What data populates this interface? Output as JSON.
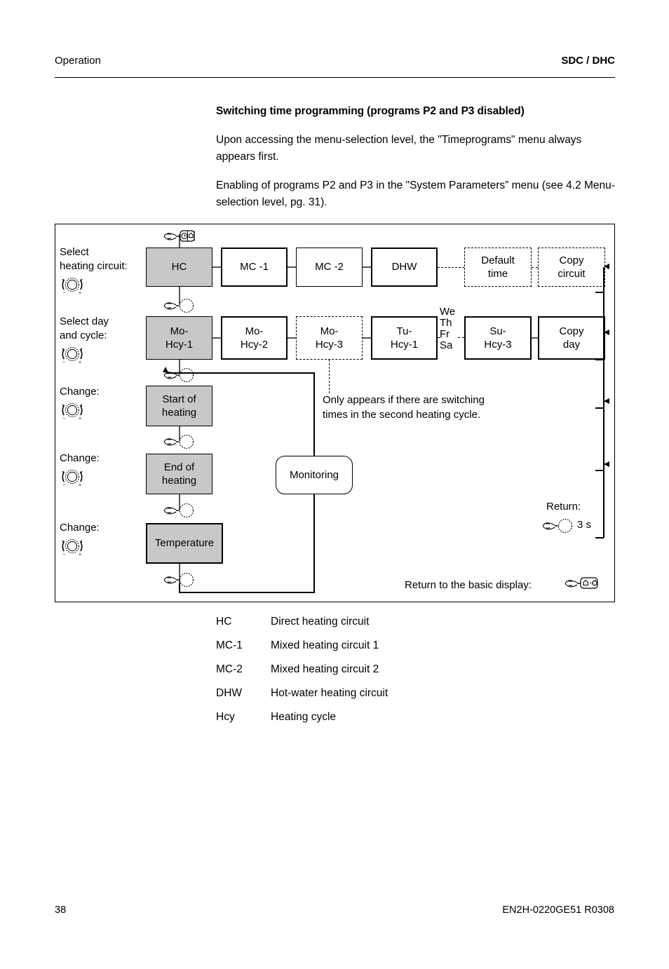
{
  "header": {
    "left": "Operation",
    "right": "SDC / DHC"
  },
  "intro": {
    "heading": "Switching time programming (programs P2 and P3 disabled)",
    "paragraph1": "Upon accessing the menu-selection level, the \"Timeprograms\" menu always appears first.",
    "paragraph2": "Enabling of programs P2 and P3 in the \"System Parameters” menu (see 4.2 Menu-selection level, pg. 31)."
  },
  "diagram": {
    "row_labels": {
      "select_circuit": "Select\nheating circuit:",
      "select_day": "Select day\nand cycle:",
      "change1": "Change:",
      "change2": "Change:",
      "change3": "Change:"
    },
    "left_labels": [
      {
        "id": "select-heating-circuit",
        "line1": "Select",
        "line2": "heating circuit:"
      },
      {
        "id": "select-day-and-cycle",
        "line1": "Select day",
        "line2": "and cycle:"
      },
      {
        "id": "change-start-heating",
        "line1": "Change:",
        "line2": ""
      },
      {
        "id": "change-end-heating",
        "line1": "Change:",
        "line2": ""
      },
      {
        "id": "change-temperature",
        "line1": "Change:",
        "line2": ""
      }
    ],
    "row_circuits": [
      {
        "id": "hc",
        "label": "HC",
        "style": "shaded"
      },
      {
        "id": "mc-1",
        "label": "MC -1",
        "style": "thick"
      },
      {
        "id": "mc-2",
        "label": "MC -2",
        "style": "plain"
      },
      {
        "id": "dhw",
        "label": "DHW",
        "style": "thick"
      },
      {
        "id": "default-time",
        "label": "Default\ntime",
        "style": "dashed"
      },
      {
        "id": "copy-circuit",
        "label": "Copy\ncircuit",
        "style": "dashed"
      }
    ],
    "row_circuits_text": {
      "hc": "HC",
      "mc1": "MC -1",
      "mc2": "MC -2",
      "dhw": "DHW",
      "default_time_l1": "Default",
      "default_time_l2": "time",
      "copy_circuit_l1": "Copy",
      "copy_circuit_l2": "circuit"
    },
    "row_days_text": {
      "mo_hcy1_l1": "Mo-",
      "mo_hcy1_l2": "Hcy-1",
      "mo_hcy2_l1": "Mo-",
      "mo_hcy2_l2": "Hcy-2",
      "mo_hcy3_l1": "Mo-",
      "mo_hcy3_l2": "Hcy-3",
      "tu_hcy1_l1": "Tu-",
      "tu_hcy1_l2": "Hcy-1",
      "su_hcy3_l1": "Su-",
      "su_hcy3_l2": "Hcy-3",
      "copy_day_l1": "Copy",
      "copy_day_l2": "day",
      "weekdays": "We\nTh\nFr\nSa"
    },
    "weekday_lines": [
      "We",
      "Th",
      "Fr",
      "Sa"
    ],
    "steps_text": {
      "start_of_heating_l1": "Start of",
      "start_of_heating_l2": "heating",
      "end_of_heating_l1": "End of",
      "end_of_heating_l2": "heating",
      "temperature": "Temperature",
      "monitoring": "Monitoring"
    },
    "note": {
      "line1": "Only appears if there are switching",
      "line2": "times in the second heating cycle."
    },
    "return": {
      "label": "Return:",
      "duration": "3 s"
    },
    "basic_display": {
      "label": "Return to the basic display:"
    },
    "icons": {
      "knob": "rotary-knob-icon",
      "press_knob": "hand-press-knob-icon",
      "press_timeprog": "hand-press-timeprogram-button-icon",
      "press_home": "hand-press-home-button-icon"
    },
    "colors": {
      "shaded_box": "#c8c8c8",
      "outline": "#000000",
      "connector": "#555555"
    }
  },
  "glossary": [
    {
      "key": "HC",
      "value": "Direct heating circuit"
    },
    {
      "key": "MC-1",
      "value": "Mixed heating circuit 1"
    },
    {
      "key": "MC-2",
      "value": "Mixed heating circuit 2"
    },
    {
      "key": "DHW",
      "value": "Hot-water heating circuit"
    },
    {
      "key": "Hcy",
      "value": "Heating cycle"
    }
  ],
  "footer": {
    "page_number": "38",
    "doc_code": "EN2H-0220GE51 R0308"
  }
}
